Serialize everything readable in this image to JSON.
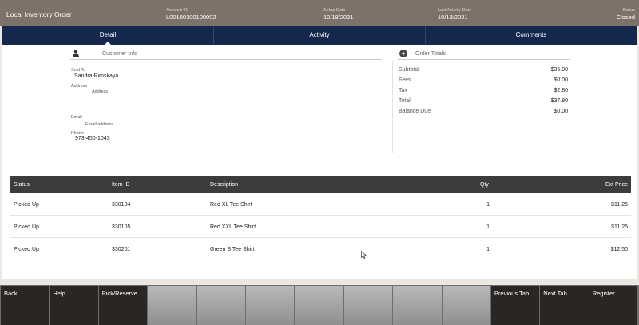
{
  "header": {
    "title": "Local Inventory Order",
    "account_label": "Account ID",
    "account_value": "L00100100100002",
    "setup_label": "Setup Date",
    "setup_value": "10/18/2021",
    "activity_label": "Last Activity Date",
    "activity_value": "10/18/2021",
    "status_label": "Status",
    "status_value": "Closed"
  },
  "tabs": [
    {
      "label": "Detail",
      "active": true
    },
    {
      "label": "Activity",
      "active": false
    },
    {
      "label": "Comments",
      "active": false
    }
  ],
  "customer": {
    "section_title": "Customer Info",
    "icon": "person-icon",
    "sold_to_label": "Sold To",
    "sold_to_value": "Sandra  Rimskaya",
    "address_label": "Address",
    "address_value": "Address",
    "email_label": "Email",
    "email_value": "Email address",
    "phone_label": "Phone",
    "phone_value": "973-450-1043"
  },
  "order_totals": {
    "section_title": "Order Totals",
    "icon": "plus-circle-icon",
    "rows": [
      {
        "label": "Subtotal",
        "value": "$35.00"
      },
      {
        "label": "Fees",
        "value": "$0.00"
      },
      {
        "label": "Tax",
        "value": "$2.80"
      },
      {
        "label": "Total",
        "value": "$37.80"
      },
      {
        "label": "Balance Due",
        "value": "$0.00"
      }
    ]
  },
  "items_table": {
    "columns": {
      "status": "Status",
      "item_id": "Item ID",
      "description": "Description",
      "qty": "Qty",
      "ext_price": "Ext Price"
    },
    "rows": [
      {
        "status": "Picked Up",
        "item_id": "330104",
        "description": "Red XL Tee Shirt",
        "qty": "1",
        "ext_price": "$11.25"
      },
      {
        "status": "Picked Up",
        "item_id": "330105",
        "description": "Red XXL Tee Shirt",
        "qty": "1",
        "ext_price": "$11.25"
      },
      {
        "status": "Picked Up",
        "item_id": "330201",
        "description": "Green S Tee Shirt",
        "qty": "1",
        "ext_price": "$12.50"
      }
    ]
  },
  "function_keys": [
    {
      "label": "Back",
      "enabled": true
    },
    {
      "label": "Help",
      "enabled": true
    },
    {
      "label": "Pick/Reserve",
      "enabled": true
    },
    {
      "label": "",
      "enabled": false
    },
    {
      "label": "",
      "enabled": false
    },
    {
      "label": "",
      "enabled": false
    },
    {
      "label": "",
      "enabled": false
    },
    {
      "label": "",
      "enabled": false
    },
    {
      "label": "",
      "enabled": false
    },
    {
      "label": "",
      "enabled": false
    },
    {
      "label": "Previous Tab",
      "enabled": true
    },
    {
      "label": "Next Tab",
      "enabled": true
    },
    {
      "label": "Register",
      "enabled": true
    }
  ],
  "colors": {
    "header_bg": "#7d7269",
    "tab_bar_bg": "#14284d",
    "table_header_bg": "#3c3c3c",
    "function_key_bg": "#2a2624"
  }
}
